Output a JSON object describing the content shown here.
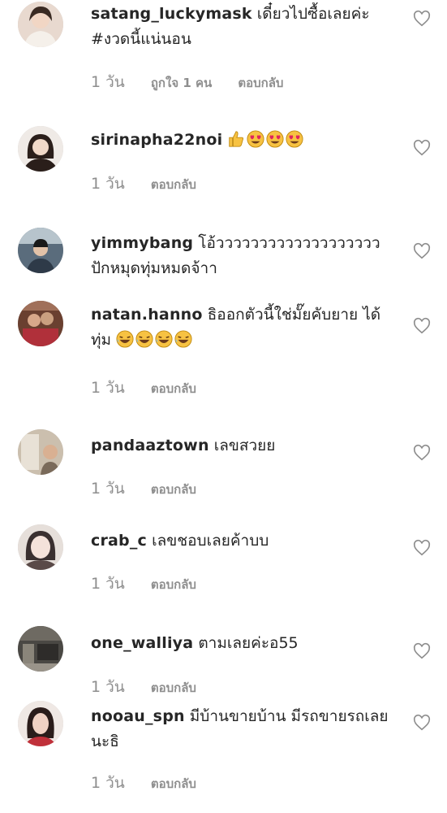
{
  "comments": [
    {
      "username": "satang_luckymask",
      "text": "เดี๋ยวไปซื้อเลยค่ะ #งวดนี้แน่นอน",
      "time": "1 วัน",
      "likes": "ถูกใจ 1 คน",
      "reply": "ตอบกลับ",
      "avatar_color": "#e8d9cf"
    },
    {
      "username": "sirinapha22noi",
      "text": "",
      "emojis": [
        "thumbs-up",
        "heart-eyes",
        "heart-eyes",
        "heart-eyes"
      ],
      "time": "1 วัน",
      "reply": "ตอบกลับ",
      "avatar_color": "#3b2e28"
    },
    {
      "username": "yimmybang",
      "text": "โอ้ววววววววววววววววววว ปักหมุดทุ่มหมดจ้าา",
      "avatar_color": "#4a5a6a"
    },
    {
      "username": "natan.hanno",
      "text": "ธิออกตัวนี้ใช่มั๊ยคับยาย ได้ทุ่ม",
      "emojis": [
        "laughing",
        "laughing",
        "laughing",
        "laughing"
      ],
      "time": "1 วัน",
      "reply": "ตอบกลับ",
      "avatar_color": "#8a5a3a"
    },
    {
      "username": "pandaaztown",
      "text": "เลขสวยย",
      "time": "1 วัน",
      "reply": "ตอบกลับ",
      "avatar_color": "#c9bba6"
    },
    {
      "username": "crab_c",
      "text": "เลขชอบเลยค้าบบ",
      "time": "1 วัน",
      "reply": "ตอบกลับ",
      "avatar_color": "#d8cfc8"
    },
    {
      "username": "one_walliya",
      "text": "ตามเลยค่ะอ55",
      "time": "1 วัน",
      "reply": "ตอบกลับ",
      "avatar_color": "#555550"
    },
    {
      "username": "nooau_spn",
      "text": "มีบ้านขายบ้าน มีรถขายรถเลยนะธิ",
      "time": "1 วัน",
      "reply": "ตอบกลับ",
      "avatar_color": "#d9c7c0"
    }
  ],
  "icons": {
    "like": "heart-outline-icon"
  },
  "colors": {
    "text": "#262626",
    "meta": "#8e8e8e",
    "emoji": "#f7c242"
  }
}
